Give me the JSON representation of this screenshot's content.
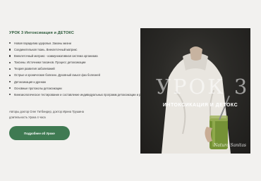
{
  "lesson": {
    "title": "УРОК 3 Интоксикация и ДЕТОКС",
    "topics": [
      "Новая парадигма здоровья. Законы жизни",
      "Соединительная ткань. Внеклеточный матрикс",
      "Внеклеточный матрикс - коммуникативная система организма",
      "Токсины. Источники токсинов. Процесс детоксикации",
      "Теория развития заболеваний",
      "Острые и хронические болезни. Духовный смысл фаз болезней",
      "Детоксикация и дренаж",
      "Основные протоколы детоксикации",
      "Кинезиологическое тестирование и составление индивидуальных программ детоксикации и ревитализации"
    ],
    "authors": "Авторы доктор Олег Гитбиндер, доктор Ирина Трушина",
    "duration": "длительность Урока 4 часа",
    "cta_label": "Подробнее об Уроке"
  },
  "promo": {
    "lesson_label": "УРОК 3",
    "topic_label": "ИНТОКСИКАЦИЯ И ДЕТОКС",
    "brand": "Natura Sanitas"
  },
  "colors": {
    "accent": "#3f7a52",
    "title_green": "#2e5a3b",
    "background": "#f2f1ef"
  }
}
